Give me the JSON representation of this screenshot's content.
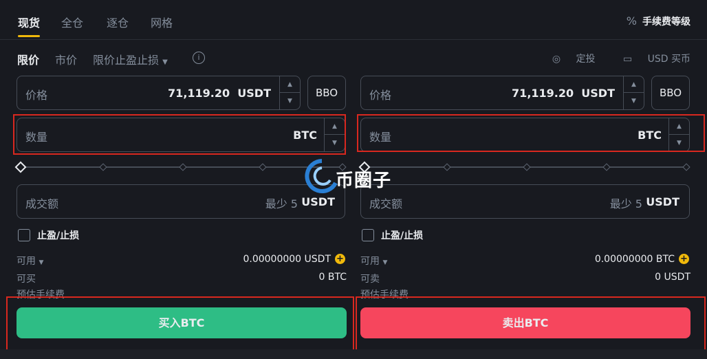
{
  "top_tabs": [
    "现货",
    "全仓",
    "逐仓",
    "网格"
  ],
  "fee_level": {
    "icon": "percent-icon",
    "label": "手续费等级"
  },
  "order_types": {
    "limit": "限价",
    "market": "市价",
    "stop_limit": "限价止盈止损",
    "info": "i"
  },
  "right_links": {
    "dca": "定投",
    "buy_with": "USD 买币"
  },
  "buy": {
    "price_label": "价格",
    "price_value": "71,119.20",
    "price_unit": "USDT",
    "bbo": "BBO",
    "qty_label": "数量",
    "qty_unit": "BTC",
    "total_label": "成交额",
    "total_min": "最少 5",
    "total_unit": "USDT",
    "tpsl": "止盈/止损",
    "avail_label": "可用",
    "avail_value": "0.00000000 USDT",
    "max_label": "可买",
    "max_value": "0 BTC",
    "fee_label": "预估手续费",
    "button": "买入BTC"
  },
  "sell": {
    "price_label": "价格",
    "price_value": "71,119.20",
    "price_unit": "USDT",
    "bbo": "BBO",
    "qty_label": "数量",
    "qty_unit": "BTC",
    "total_label": "成交额",
    "total_min": "最少 5",
    "total_unit": "USDT",
    "tpsl": "止盈/止损",
    "avail_label": "可用",
    "avail_value": "0.00000000 BTC",
    "max_label": "可卖",
    "max_value": "0 USDT",
    "fee_label": "预估手续费",
    "button": "卖出BTC"
  },
  "watermark": "币圈子",
  "colors": {
    "buy": "#2ebd85",
    "sell": "#f6465d",
    "accent": "#f0b90b",
    "highlight": "#d9281f"
  }
}
